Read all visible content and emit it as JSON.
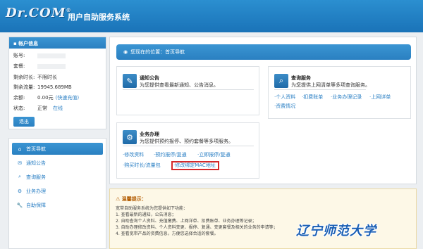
{
  "header": {
    "logo": "Dr.COM",
    "logo_mark": "®",
    "title": "用户自助服务系统"
  },
  "account": {
    "heading": "帐户信息",
    "rows": [
      {
        "label": "账号:",
        "value": ""
      },
      {
        "label": "套餐:",
        "value": ""
      },
      {
        "label": "剩余时长:",
        "value": "不限时长"
      },
      {
        "label": "剩余流量:",
        "value": "19945.689MB"
      },
      {
        "label": "余额:",
        "value": "0.00元",
        "link": "(快速充值)"
      },
      {
        "label": "状态:",
        "value": "正常",
        "link": "在线"
      }
    ],
    "logout_label": "退出"
  },
  "nav": {
    "items": [
      {
        "label": "首页导航",
        "icon": "home-icon",
        "glyph": "⌂"
      },
      {
        "label": "通知公告",
        "icon": "mail-icon",
        "glyph": "✉"
      },
      {
        "label": "查询服务",
        "icon": "search-icon",
        "glyph": "⌕"
      },
      {
        "label": "业务办理",
        "icon": "gear-icon",
        "glyph": "⚙"
      },
      {
        "label": "自助保障",
        "icon": "wrench-icon",
        "glyph": "🔧"
      }
    ]
  },
  "main": {
    "breadcrumb": "您现在的位置：首页导航",
    "notice_card": {
      "title": "通知公告",
      "desc": "为您提供查看最新通知、公告消息。",
      "icon": "edit-icon"
    },
    "query_card": {
      "title": "查询服务",
      "desc": "为您提供上网清单等多项查询服务。",
      "icon": "search-icon",
      "links": [
        "·个人资料",
        "·扣费账单",
        "·业务办理记录",
        "·上网详单",
        "·资费情况"
      ]
    },
    "business_card": {
      "title": "业务办理",
      "desc": "为您提供预约报停、预约套餐等多项服务。",
      "icon": "gear-icon",
      "links": [
        "·修改资料",
        "·预约报停/复通",
        "·立即报停/复通",
        "·购买时长/流量包",
        "·修改绑定MAC地址"
      ]
    }
  },
  "tips": {
    "title": "温馨提示：",
    "lines": [
      "宽带自助服务系统为您提供如下功能：",
      "1. 查看最新的通知，公告消息；",
      "2. 自助查询个人资料、充值缴费、上网详单、扣费账单、业务办理等记录；",
      "3. 自助办理修改资料、个人资料变更、报停、复通、变更套餐及相关的业务的申请等；",
      "4. 查看宽带产品的资费信息，方便您选择合适的套餐。"
    ]
  },
  "watermark": "辽宁师范大学",
  "colors": {
    "header_blue": "#1a73b8",
    "accent_blue": "#2a80c1",
    "link_blue": "#2a7fc4",
    "highlight_red": "#d42a2a",
    "notice_bg": "#fdf8e7"
  }
}
